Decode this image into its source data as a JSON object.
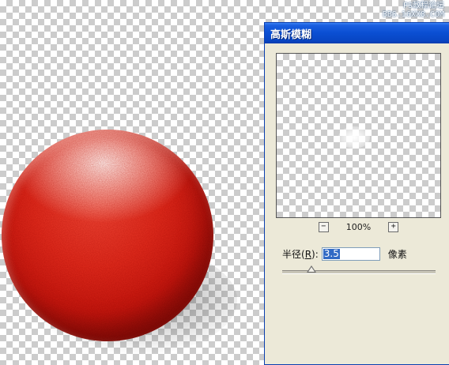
{
  "watermark": {
    "line1": "PS教程论坛",
    "line2": "BBS.16XX8.COM"
  },
  "dialog": {
    "title": "高斯模糊",
    "zoom": {
      "minus_label": "−",
      "value": "100%",
      "plus_label": "+"
    },
    "radius": {
      "label_prefix": "半径(",
      "label_key": "R",
      "label_suffix": "):",
      "value": "3.5",
      "unit": "像素"
    },
    "slider": {
      "level_fraction": 0.19
    }
  },
  "colors": {
    "titlebar": "#0a4ed2",
    "dialog_bg": "#ece9d8",
    "selection": "#316ac5",
    "sphere": "#e02b1c"
  }
}
